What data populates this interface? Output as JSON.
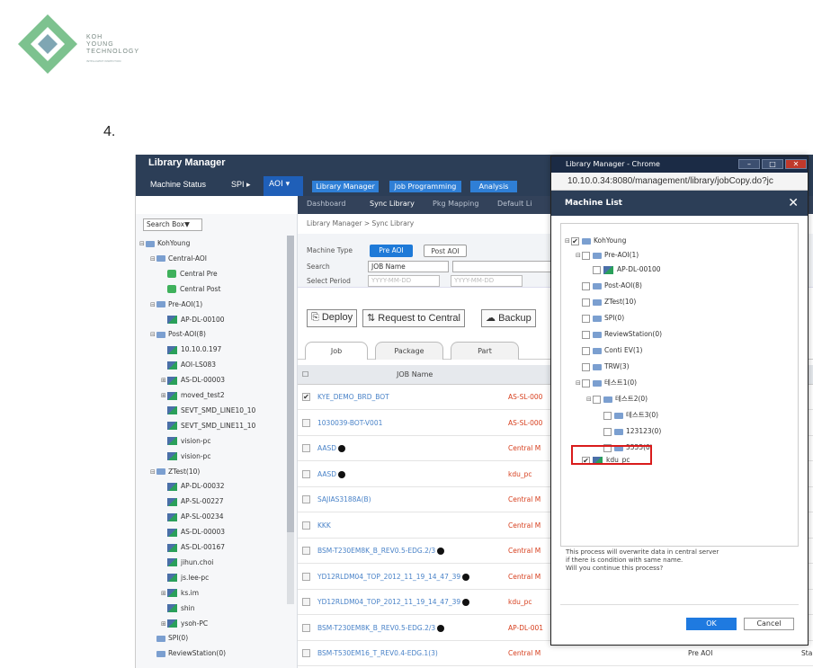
{
  "logo": {
    "lines": [
      "KOH",
      "YOUNG",
      "TECHNOLOGY"
    ],
    "sub": "INTELLIGENT INSPECTION"
  },
  "step": "4.",
  "app": {
    "title": "Library Manager",
    "menu": {
      "machine_status": "Machine Status",
      "spi": "SPI ▸",
      "aoi": "AOI ▾",
      "library_manager": "Library Manager",
      "job_programming": "Job Programming",
      "analysis": "Analysis"
    },
    "subnav": [
      "Dashboard",
      "Sync Library",
      "Pkg Mapping",
      "Default Li"
    ]
  },
  "sidebar": {
    "search": "Search Box▼",
    "tree": [
      {
        "label": "KohYoung",
        "icon": "folder",
        "level": 0,
        "exp": "⊟"
      },
      {
        "label": "Central-AOI",
        "icon": "folder",
        "level": 1,
        "exp": "⊟"
      },
      {
        "label": "Central Pre",
        "icon": "green",
        "level": 2,
        "exp": ""
      },
      {
        "label": "Central Post",
        "icon": "green",
        "level": 2,
        "exp": ""
      },
      {
        "label": "Pre-AOI(1)",
        "icon": "folder",
        "level": 1,
        "exp": "⊟"
      },
      {
        "label": "AP-DL-00100",
        "icon": "pc",
        "level": 2,
        "exp": ""
      },
      {
        "label": "Post-AOI(8)",
        "icon": "folder",
        "level": 1,
        "exp": "⊟"
      },
      {
        "label": "10.10.0.197",
        "icon": "pc",
        "level": 2,
        "exp": ""
      },
      {
        "label": "AOI-LS083",
        "icon": "pc",
        "level": 2,
        "exp": ""
      },
      {
        "label": "AS-DL-00003",
        "icon": "pc",
        "level": 2,
        "exp": "⊞"
      },
      {
        "label": "moved_test2",
        "icon": "pc",
        "level": 2,
        "exp": "⊞"
      },
      {
        "label": "SEVT_SMD_LINE10_10",
        "icon": "pc",
        "level": 2,
        "exp": ""
      },
      {
        "label": "SEVT_SMD_LINE11_10",
        "icon": "pc",
        "level": 2,
        "exp": ""
      },
      {
        "label": "vision-pc",
        "icon": "pc",
        "level": 2,
        "exp": ""
      },
      {
        "label": "vision-pc",
        "icon": "pc",
        "level": 2,
        "exp": ""
      },
      {
        "label": "ZTest(10)",
        "icon": "folder",
        "level": 1,
        "exp": "⊟"
      },
      {
        "label": "AP-DL-00032",
        "icon": "pc",
        "level": 2,
        "exp": ""
      },
      {
        "label": "AP-SL-00227",
        "icon": "pc",
        "level": 2,
        "exp": ""
      },
      {
        "label": "AP-SL-00234",
        "icon": "pc",
        "level": 2,
        "exp": ""
      },
      {
        "label": "AS-DL-00003",
        "icon": "pc",
        "level": 2,
        "exp": ""
      },
      {
        "label": "AS-DL-00167",
        "icon": "pc",
        "level": 2,
        "exp": ""
      },
      {
        "label": "jihun.choi",
        "icon": "pc",
        "level": 2,
        "exp": ""
      },
      {
        "label": "js.lee-pc",
        "icon": "pc",
        "level": 2,
        "exp": ""
      },
      {
        "label": "ks.im",
        "icon": "pc",
        "level": 2,
        "exp": "⊞"
      },
      {
        "label": "shin",
        "icon": "pc",
        "level": 2,
        "exp": ""
      },
      {
        "label": "ysoh-PC",
        "icon": "pc",
        "level": 2,
        "exp": "⊞"
      },
      {
        "label": "SPI(0)",
        "icon": "folder",
        "level": 1,
        "exp": ""
      },
      {
        "label": "ReviewStation(0)",
        "icon": "folder",
        "level": 1,
        "exp": ""
      }
    ]
  },
  "main": {
    "breadcrumb": "Library Manager  >  Sync Library",
    "machine_type_label": "Machine Type",
    "pre_aoi": "Pre AOI",
    "post_aoi": "Post AOI",
    "search_label": "Search",
    "search_select": "JOB Name",
    "period_label": "Select Period",
    "date_placeholder": "YYYY-MM-DD",
    "actions": {
      "deploy": "Deploy",
      "request": "Request to Central",
      "backup": "Backup"
    },
    "tabs": [
      "Job",
      "Package",
      "Part"
    ],
    "column_job": "JOB Name",
    "rows": [
      {
        "checked": "✔",
        "job": "KYE_DEMO_BRD_BOT",
        "src": "AS-SL-000",
        "pre": "",
        "st": "",
        "dot": false
      },
      {
        "checked": "",
        "job": "1030039-BOT-V001",
        "src": "AS-SL-000",
        "pre": "",
        "st": "",
        "dot": false
      },
      {
        "checked": "",
        "job": "AASD",
        "src": "Central M",
        "pre": "",
        "st": "",
        "dot": true
      },
      {
        "checked": "",
        "job": "AASD",
        "src": "kdu_pc",
        "pre": "",
        "st": "",
        "dot": true
      },
      {
        "checked": "",
        "job": "SAJIAS3188A(B)",
        "src": "Central M",
        "pre": "",
        "st": "",
        "dot": false
      },
      {
        "checked": "",
        "job": "KKK",
        "src": "Central M",
        "pre": "",
        "st": "",
        "dot": false
      },
      {
        "checked": "",
        "job": "BSM-T230EM8K_B_REV0.5-EDG.2/3",
        "src": "Central M",
        "pre": "",
        "st": "",
        "dot": true
      },
      {
        "checked": "",
        "job": "YD12RLDM04_TOP_2012_11_19_14_47_39",
        "src": "Central M",
        "pre": "",
        "st": "",
        "dot": true
      },
      {
        "checked": "",
        "job": "YD12RLDM04_TOP_2012_11_19_14_47_39",
        "src": "kdu_pc",
        "pre": "",
        "st": "",
        "dot": true
      },
      {
        "checked": "",
        "job": "BSM-T230EM8K_B_REV0.5-EDG.2/3",
        "src": "AP-DL-001",
        "pre": "",
        "st": "",
        "dot": true
      },
      {
        "checked": "",
        "job": "BSM-T530EM16_T_REV0.4-EDG.1(3)",
        "src": "Central M",
        "pre": "Pre AOI",
        "st": "Sta",
        "dot": false
      }
    ]
  },
  "popup": {
    "title": "Library Manager - Chrome",
    "url": "10.10.0.34:8080/management/library/jobCopy.do?jc",
    "header": "Machine List",
    "close": "✕",
    "tree": [
      {
        "label": "KohYoung",
        "exp": "⊟",
        "checked": "✔",
        "type": "folder",
        "level": 0
      },
      {
        "label": "Pre-AOI(1)",
        "exp": "⊟",
        "checked": "",
        "type": "folder",
        "level": 1
      },
      {
        "label": "AP-DL-00100",
        "exp": "",
        "checked": "",
        "type": "pc",
        "level": 2
      },
      {
        "label": "Post-AOI(8)",
        "exp": "",
        "checked": "",
        "type": "folder",
        "level": 1
      },
      {
        "label": "ZTest(10)",
        "exp": "",
        "checked": "",
        "type": "folder",
        "level": 1
      },
      {
        "label": "SPI(0)",
        "exp": "",
        "checked": "",
        "type": "folder",
        "level": 1
      },
      {
        "label": "ReviewStation(0)",
        "exp": "",
        "checked": "",
        "type": "folder",
        "level": 1
      },
      {
        "label": "Conti EV(1)",
        "exp": "",
        "checked": "",
        "type": "folder",
        "level": 1
      },
      {
        "label": "TRW(3)",
        "exp": "",
        "checked": "",
        "type": "folder",
        "level": 1
      },
      {
        "label": "테스트1(0)",
        "exp": "⊟",
        "checked": "",
        "type": "folder",
        "level": 1
      },
      {
        "label": "테스트2(0)",
        "exp": "⊟",
        "checked": "",
        "type": "folder",
        "level": 2
      },
      {
        "label": "테스트3(0)",
        "exp": "",
        "checked": "",
        "type": "folder",
        "level": 3
      },
      {
        "label": "123123(0)",
        "exp": "",
        "checked": "",
        "type": "folder",
        "level": 3
      },
      {
        "label": "5555(0)",
        "exp": "",
        "checked": "",
        "type": "folder",
        "level": 3
      },
      {
        "label": "kdu_pc",
        "exp": "",
        "checked": "✔",
        "type": "pc",
        "level": 1
      }
    ],
    "message": [
      "This process will overwrite data in central server",
      "if there is condition with same name.",
      "Will you continue this process?"
    ],
    "ok": "OK",
    "cancel": "Cancel"
  },
  "colors": {
    "accent": "#1e7ad8",
    "topbar": "#2c3e57",
    "highlight": "#d91b1b",
    "link": "#4a83c8",
    "source": "#d7401f"
  }
}
